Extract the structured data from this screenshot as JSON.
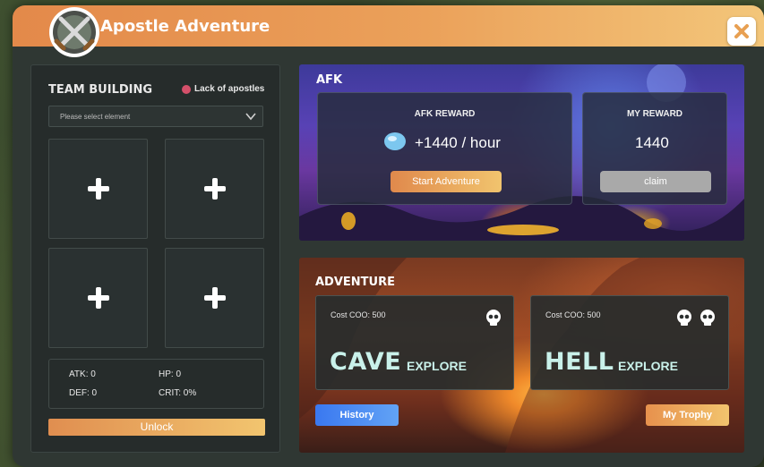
{
  "window": {
    "title": "Apostle Adventure"
  },
  "team_building": {
    "title": "TEAM BUILDING",
    "warning": "Lack of apostles",
    "select_placeholder": "Please select element",
    "slots": [
      "+",
      "+",
      "+",
      "+"
    ],
    "stats": {
      "atk": "ATK: 0",
      "hp": "HP: 0",
      "def": "DEF: 0",
      "crit": "CRIT: 0%"
    },
    "unlock_label": "Unlock"
  },
  "afk": {
    "title": "AFK",
    "afk_reward_label": "AFK REWARD",
    "afk_reward_value": "+1440 / hour",
    "start_label": "Start Adventure",
    "my_reward_label": "MY REWARD",
    "my_reward_value": "1440",
    "claim_label": "claim"
  },
  "adventure": {
    "title": "ADVENTURE",
    "cards": [
      {
        "cost": "Cost COO: 500",
        "name": "CAVE",
        "action": "EXPLORE",
        "skulls": 1
      },
      {
        "cost": "Cost COO: 500",
        "name": "HELL",
        "action": "EXPLORE",
        "skulls": 2
      }
    ],
    "history_label": "History",
    "trophy_label": "My Trophy"
  },
  "colors": {
    "header_start": "#e3894a",
    "header_end": "#f3c67a",
    "warning_dot": "#d4506a",
    "history_blue": "#3a78f0",
    "accent_text": "#c9f1ea"
  },
  "icons": {
    "logo": "crossed-swords-shield-icon",
    "close": "close-icon",
    "chevron": "chevron-down-icon",
    "coin": "gem-coin-icon",
    "skull": "skull-icon",
    "plus": "plus-icon"
  }
}
